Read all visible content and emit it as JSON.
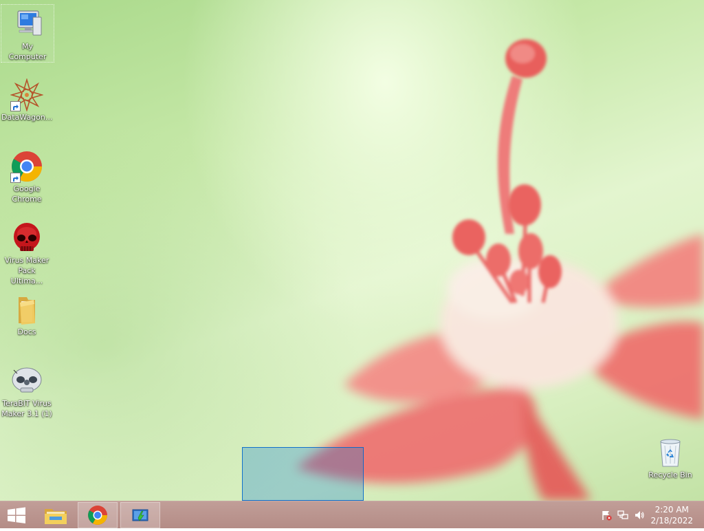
{
  "desktop": {
    "icons": [
      {
        "label": "My Computer",
        "icon": "computer-icon"
      },
      {
        "label": "DataWagon...",
        "icon": "mandala-icon"
      },
      {
        "label": "Google Chrome",
        "icon": "chrome-icon"
      },
      {
        "label": "Virus Maker Pack Ultima...",
        "icon": "red-skull-icon"
      },
      {
        "label": "Docs",
        "icon": "folder-icon"
      },
      {
        "label": "TeraBIT Virus Maker 3.1 (1)",
        "icon": "skull-icon"
      },
      {
        "label": "Recycle Bin",
        "icon": "recycle-bin-icon"
      }
    ]
  },
  "taskbar": {
    "start_icon": "windows-logo-icon",
    "pinned": [
      {
        "name": "File Explorer",
        "icon": "file-explorer-icon"
      },
      {
        "name": "Google Chrome",
        "icon": "chrome-icon"
      },
      {
        "name": "Application",
        "icon": "app-icon"
      }
    ],
    "tray": {
      "icons": [
        "action-center-flag-icon",
        "network-icon",
        "volume-icon"
      ],
      "time": "2:20 AM",
      "date": "2/18/2022"
    }
  },
  "colors": {
    "taskbar": "#b8918b",
    "selection": "#0078d7",
    "wallpaper_green": "#c6e8a8",
    "flower": "#f0706b"
  }
}
